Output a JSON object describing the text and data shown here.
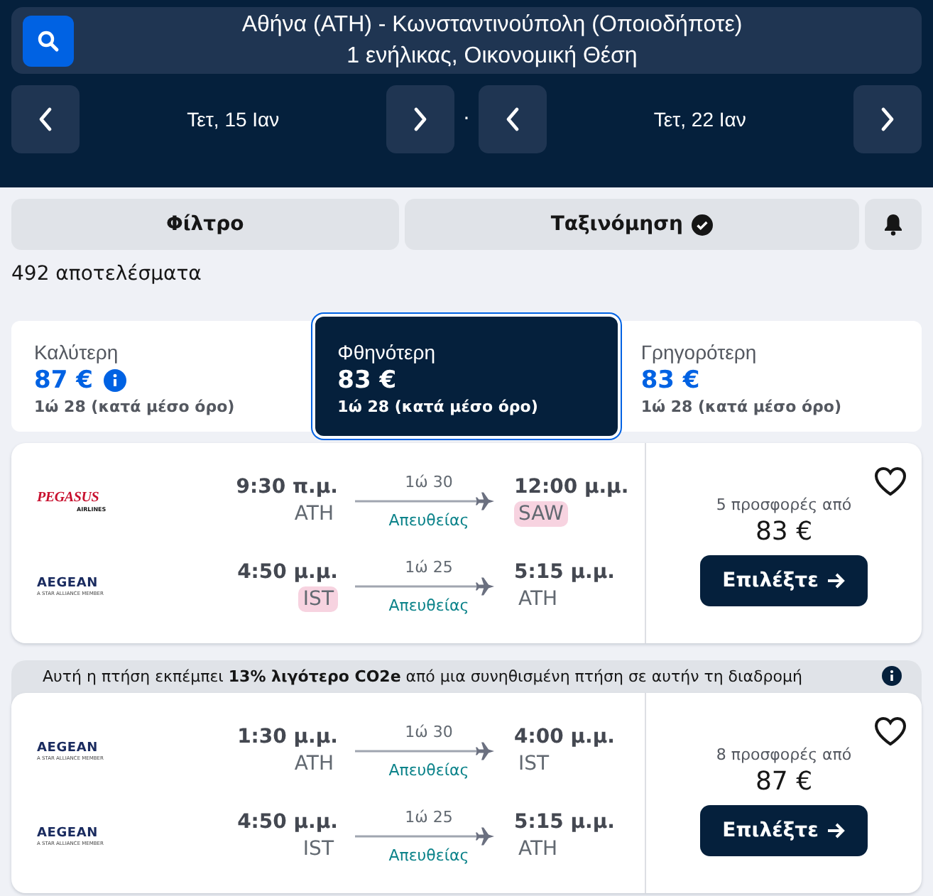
{
  "search": {
    "route": "Αθήνα (ATH) - Κωνσταντινούπολη (Οποιοδήποτε)",
    "passengers": "1 ενήλικας, Οικονομική Θέση"
  },
  "dates": [
    {
      "label": "Τετ, 15 Ιαν"
    },
    {
      "label": "Τετ, 22 Ιαν"
    }
  ],
  "date_separator": "·",
  "toolbar": {
    "filter": "Φίλτρο",
    "sort": "Ταξινόμηση",
    "sort_active": true
  },
  "results_count": "492 αποτελέσματα",
  "sort_tabs": [
    {
      "label": "Καλύτερη",
      "price": "87 €",
      "duration": "1ώ 28 (κατά μέσο όρο)",
      "info": true,
      "selected": false
    },
    {
      "label": "Φθηνότερη",
      "price": "83 €",
      "duration": "1ώ 28 (κατά μέσο όρο)",
      "info": false,
      "selected": true
    },
    {
      "label": "Γρηγορότερη",
      "price": "83 €",
      "duration": "1ώ 28 (κατά μέσο όρο)",
      "info": false,
      "selected": false
    }
  ],
  "results": [
    {
      "offers": "5 προσφορές από",
      "price": "83 €",
      "button": "Επιλέξτε",
      "legs": [
        {
          "airline": {
            "kind": "pegasus",
            "name": "PEGASUS",
            "tagline": "AIRLINES"
          },
          "depart_time": "9:30 π.μ.",
          "depart_airport": "ATH",
          "depart_highlight": false,
          "duration": "1ώ 30",
          "stops": "Απευθείας",
          "arrive_time": "12:00 μ.μ.",
          "arrive_airport": "SAW",
          "arrive_highlight": true
        },
        {
          "airline": {
            "kind": "aegean",
            "name": "AEGEAN",
            "tagline": "A STAR ALLIANCE MEMBER"
          },
          "depart_time": "4:50 μ.μ.",
          "depart_airport": "IST",
          "depart_highlight": true,
          "duration": "1ώ 25",
          "stops": "Απευθείας",
          "arrive_time": "5:15 μ.μ.",
          "arrive_airport": "ATH",
          "arrive_highlight": false
        }
      ]
    },
    {
      "banner": "Αυτή η πτήση εκπέμπει **13% λιγότερο CO2e** από μια συνηθισμένη πτήση σε αυτήν τη διαδρομή",
      "offers": "8 προσφορές από",
      "price": "87 €",
      "button": "Επιλέξτε",
      "legs": [
        {
          "airline": {
            "kind": "aegean",
            "name": "AEGEAN",
            "tagline": "A STAR ALLIANCE MEMBER"
          },
          "depart_time": "1:30 μ.μ.",
          "depart_airport": "ATH",
          "depart_highlight": false,
          "duration": "1ώ 30",
          "stops": "Απευθείας",
          "arrive_time": "4:00 μ.μ.",
          "arrive_airport": "IST",
          "arrive_highlight": false
        },
        {
          "airline": {
            "kind": "aegean",
            "name": "AEGEAN",
            "tagline": "A STAR ALLIANCE MEMBER"
          },
          "depart_time": "4:50 μ.μ.",
          "depart_airport": "IST",
          "depart_highlight": false,
          "duration": "1ώ 25",
          "stops": "Απευθείας",
          "arrive_time": "5:15 μ.μ.",
          "arrive_airport": "ATH",
          "arrive_highlight": false
        }
      ]
    }
  ]
}
